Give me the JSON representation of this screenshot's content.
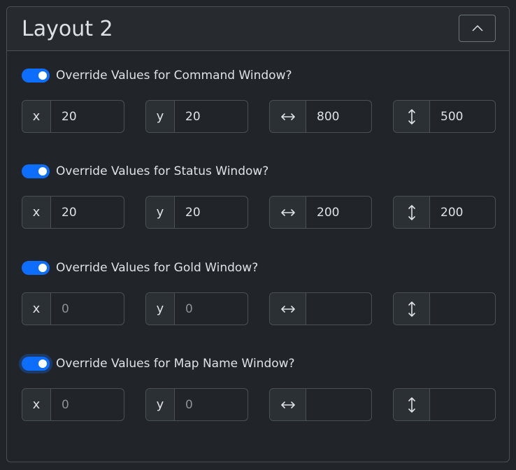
{
  "panel": {
    "title": "Layout 2"
  },
  "sections": [
    {
      "label": "Override Values for Command Window?",
      "enabled": true,
      "fields": [
        {
          "prefix": "x",
          "value": "20",
          "placeholder": ""
        },
        {
          "prefix": "y",
          "value": "20",
          "placeholder": ""
        },
        {
          "prefix_icon": "horizontal-arrows-icon",
          "value": "800",
          "placeholder": ""
        },
        {
          "prefix_icon": "vertical-arrows-icon",
          "value": "500",
          "placeholder": ""
        }
      ]
    },
    {
      "label": "Override Values for Status Window?",
      "enabled": true,
      "fields": [
        {
          "prefix": "x",
          "value": "20",
          "placeholder": ""
        },
        {
          "prefix": "y",
          "value": "20",
          "placeholder": ""
        },
        {
          "prefix_icon": "horizontal-arrows-icon",
          "value": "200",
          "placeholder": ""
        },
        {
          "prefix_icon": "vertical-arrows-icon",
          "value": "200",
          "placeholder": ""
        }
      ]
    },
    {
      "label": "Override Values for Gold Window?",
      "enabled": true,
      "fields": [
        {
          "prefix": "x",
          "value": "",
          "placeholder": "0"
        },
        {
          "prefix": "y",
          "value": "",
          "placeholder": "0"
        },
        {
          "prefix_icon": "horizontal-arrows-icon",
          "value": "",
          "placeholder": ""
        },
        {
          "prefix_icon": "vertical-arrows-icon",
          "value": "",
          "placeholder": ""
        }
      ]
    },
    {
      "label": "Override Values for Map Name Window?",
      "enabled": true,
      "focused": true,
      "fields": [
        {
          "prefix": "x",
          "value": "",
          "placeholder": "0"
        },
        {
          "prefix": "y",
          "value": "",
          "placeholder": "0"
        },
        {
          "prefix_icon": "horizontal-arrows-icon",
          "value": "",
          "placeholder": ""
        },
        {
          "prefix_icon": "vertical-arrows-icon",
          "value": "",
          "placeholder": ""
        }
      ]
    }
  ],
  "colors": {
    "accent": "#0d6efd",
    "background": "#212529",
    "border": "#495057"
  }
}
